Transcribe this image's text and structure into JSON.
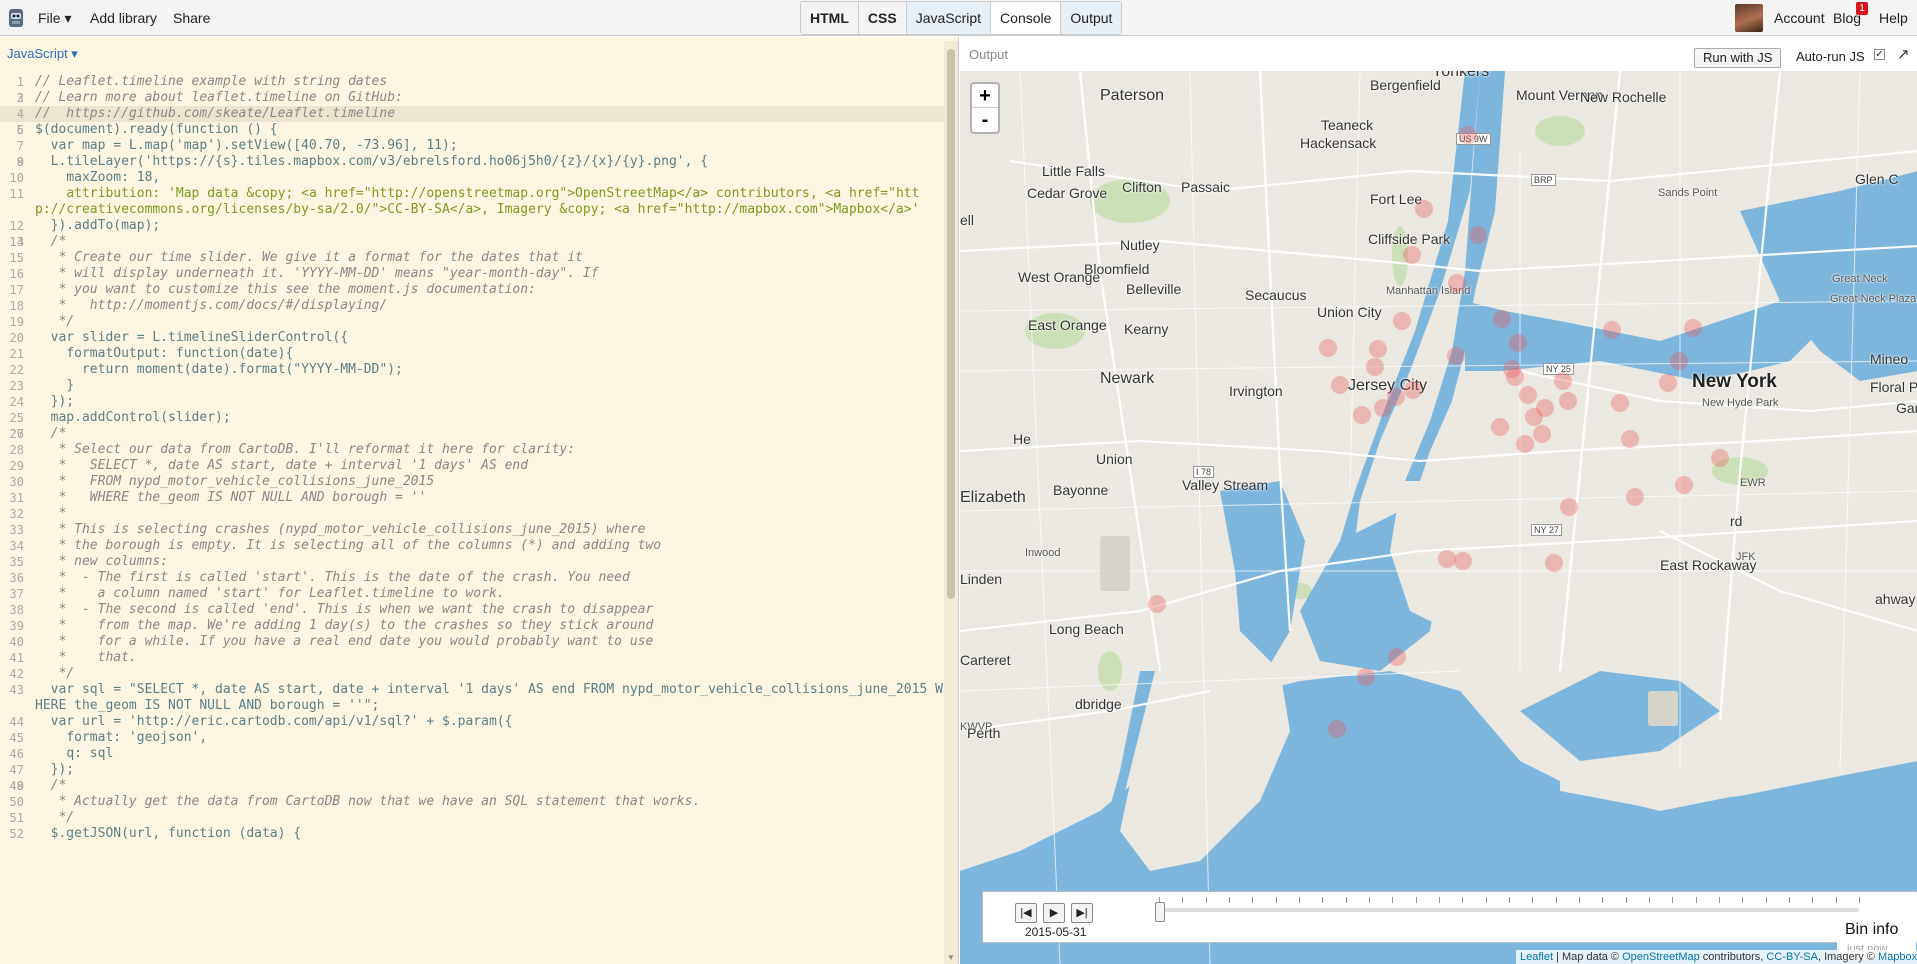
{
  "topbar": {
    "menus": [
      {
        "label": "File ▾"
      },
      {
        "label": "Add library"
      },
      {
        "label": "Share"
      }
    ],
    "panels": [
      {
        "label": "HTML",
        "state": "bold"
      },
      {
        "label": "CSS",
        "state": "bold"
      },
      {
        "label": "JavaScript",
        "state": "on"
      },
      {
        "label": "Console",
        "state": ""
      },
      {
        "label": "Output",
        "state": "on"
      }
    ],
    "account_label": "Account",
    "blog_label": "Blog",
    "blog_badge": "1",
    "help_label": "Help"
  },
  "editor": {
    "language_label": "JavaScript ▾",
    "lines": [
      {
        "n": "1",
        "t": "// Leaflet.timeline example with string dates",
        "k": "com"
      },
      {
        "n": "2",
        "t": "",
        "k": ""
      },
      {
        "n": "3",
        "t": "// Learn more about leaflet.timeline on GitHub:",
        "k": "com"
      },
      {
        "n": "4",
        "t": "//  https://github.com/skeate/Leaflet.timeline",
        "k": "com",
        "hl": true
      },
      {
        "n": "5",
        "t": "",
        "k": ""
      },
      {
        "n": "6",
        "t": "$(document).ready(function () {",
        "k": "code"
      },
      {
        "n": "7",
        "t": "  var map = L.map('map').setView([40.70, -73.96], 11);",
        "k": "code"
      },
      {
        "n": "8",
        "t": "",
        "k": ""
      },
      {
        "n": "9",
        "t": "  L.tileLayer('https://{s}.tiles.mapbox.com/v3/ebrelsford.ho06j5h0/{z}/{x}/{y}.png', {",
        "k": "code"
      },
      {
        "n": "10",
        "t": "    maxZoom: 18,",
        "k": "code"
      },
      {
        "n": "11",
        "t": "    attribution: 'Map data &copy; <a href=\"http://openstreetmap.org\">OpenStreetMap</a> contributors, <a href=\"http://creativecommons.org/licenses/by-sa/2.0/\">CC-BY-SA</a>, Imagery &copy; <a href=\"http://mapbox.com\">Mapbox</a>'",
        "k": "str"
      },
      {
        "n": "12",
        "t": "  }).addTo(map);",
        "k": "code"
      },
      {
        "n": "13",
        "t": "",
        "k": ""
      },
      {
        "n": "14",
        "t": "  /*",
        "k": "com"
      },
      {
        "n": "15",
        "t": "   * Create our time slider. We give it a format for the dates that it",
        "k": "com"
      },
      {
        "n": "16",
        "t": "   * will display underneath it. 'YYYY-MM-DD' means \"year-month-day\". If",
        "k": "com"
      },
      {
        "n": "17",
        "t": "   * you want to customize this see the moment.js documentation:",
        "k": "com"
      },
      {
        "n": "18",
        "t": "   *   http://momentjs.com/docs/#/displaying/",
        "k": "com"
      },
      {
        "n": "19",
        "t": "   */",
        "k": "com"
      },
      {
        "n": "20",
        "t": "  var slider = L.timelineSliderControl({",
        "k": "code"
      },
      {
        "n": "21",
        "t": "    formatOutput: function(date){",
        "k": "code"
      },
      {
        "n": "22",
        "t": "      return moment(date).format(\"YYYY-MM-DD\");",
        "k": "code"
      },
      {
        "n": "23",
        "t": "    }",
        "k": "code"
      },
      {
        "n": "24",
        "t": "  });",
        "k": "code"
      },
      {
        "n": "25",
        "t": "  map.addControl(slider);",
        "k": "code"
      },
      {
        "n": "26",
        "t": "",
        "k": ""
      },
      {
        "n": "27",
        "t": "  /*",
        "k": "com"
      },
      {
        "n": "28",
        "t": "   * Select our data from CartoDB. I'll reformat it here for clarity:",
        "k": "com"
      },
      {
        "n": "29",
        "t": "   *   SELECT *, date AS start, date + interval '1 days' AS end",
        "k": "com"
      },
      {
        "n": "30",
        "t": "   *   FROM nypd_motor_vehicle_collisions_june_2015",
        "k": "com"
      },
      {
        "n": "31",
        "t": "   *   WHERE the_geom IS NOT NULL AND borough = ''",
        "k": "com"
      },
      {
        "n": "32",
        "t": "   *",
        "k": "com"
      },
      {
        "n": "33",
        "t": "   * This is selecting crashes (nypd_motor_vehicle_collisions_june_2015) where",
        "k": "com"
      },
      {
        "n": "34",
        "t": "   * the borough is empty. It is selecting all of the columns (*) and adding two",
        "k": "com"
      },
      {
        "n": "35",
        "t": "   * new columns:",
        "k": "com"
      },
      {
        "n": "36",
        "t": "   *  - The first is called 'start'. This is the date of the crash. You need",
        "k": "com"
      },
      {
        "n": "37",
        "t": "   *    a column named 'start' for Leaflet.timeline to work.",
        "k": "com"
      },
      {
        "n": "38",
        "t": "   *  - The second is called 'end'. This is when we want the crash to disappear",
        "k": "com"
      },
      {
        "n": "39",
        "t": "   *    from the map. We're adding 1 day(s) to the crashes so they stick around",
        "k": "com"
      },
      {
        "n": "40",
        "t": "   *    for a while. If you have a real end date you would probably want to use",
        "k": "com"
      },
      {
        "n": "41",
        "t": "   *    that.",
        "k": "com"
      },
      {
        "n": "42",
        "t": "   */",
        "k": "com"
      },
      {
        "n": "43",
        "t": "  var sql = \"SELECT *, date AS start, date + interval '1 days' AS end FROM nypd_motor_vehicle_collisions_june_2015 WHERE the_geom IS NOT NULL AND borough = ''\";",
        "k": "code"
      },
      {
        "n": "44",
        "t": "  var url = 'http://eric.cartodb.com/api/v1/sql?' + $.param({",
        "k": "code"
      },
      {
        "n": "45",
        "t": "    format: 'geojson',",
        "k": "code"
      },
      {
        "n": "46",
        "t": "    q: sql",
        "k": "code"
      },
      {
        "n": "47",
        "t": "  });",
        "k": "code"
      },
      {
        "n": "48",
        "t": "",
        "k": ""
      },
      {
        "n": "49",
        "t": "  /*",
        "k": "com"
      },
      {
        "n": "50",
        "t": "   * Actually get the data from CartoDB now that we have an SQL statement that works.",
        "k": "com"
      },
      {
        "n": "51",
        "t": "   */",
        "k": "com"
      },
      {
        "n": "52",
        "t": "  $.getJSON(url, function (data) {",
        "k": "code"
      }
    ]
  },
  "output": {
    "title": "Output",
    "run_button": "Run with JS",
    "autorun_label": "Auto-run JS",
    "autorun_checked": "✓",
    "expand_icon": "↗"
  },
  "map": {
    "zoom_in": "+",
    "zoom_out": "-",
    "places": [
      {
        "name": "Bergenfield",
        "cls": ""
      },
      {
        "name": "Yonkers",
        "cls": "mid"
      },
      {
        "name": "Paterson",
        "cls": "mid"
      },
      {
        "name": "Mount Vernon",
        "cls": ""
      },
      {
        "name": "New Rochelle",
        "cls": ""
      },
      {
        "name": "Teaneck",
        "cls": ""
      },
      {
        "name": "Hackensack",
        "cls": ""
      },
      {
        "name": "Little Falls",
        "cls": ""
      },
      {
        "name": "Cedar Grove",
        "cls": ""
      },
      {
        "name": "Clifton",
        "cls": ""
      },
      {
        "name": "Passaic",
        "cls": ""
      },
      {
        "name": "Fort Lee",
        "cls": ""
      },
      {
        "name": "Glen C",
        "cls": ""
      },
      {
        "name": "Sands Point",
        "cls": "small"
      },
      {
        "name": "Cliffside Park",
        "cls": ""
      },
      {
        "name": "Nutley",
        "cls": ""
      },
      {
        "name": "West Orange",
        "cls": ""
      },
      {
        "name": "Bloomfield",
        "cls": ""
      },
      {
        "name": "Belleville",
        "cls": ""
      },
      {
        "name": "Manhattan Island",
        "cls": "small"
      },
      {
        "name": "Great Neck",
        "cls": "small"
      },
      {
        "name": "Great Neck Plaza",
        "cls": "small"
      },
      {
        "name": "Secaucus",
        "cls": ""
      },
      {
        "name": "Union City",
        "cls": ""
      },
      {
        "name": "East Orange",
        "cls": ""
      },
      {
        "name": "Kearny",
        "cls": ""
      },
      {
        "name": "Mineo",
        "cls": ""
      },
      {
        "name": "Newark",
        "cls": "mid"
      },
      {
        "name": "Irvington",
        "cls": ""
      },
      {
        "name": "Jersey City",
        "cls": "mid"
      },
      {
        "name": "New York",
        "cls": "big"
      },
      {
        "name": "New Hyde Park",
        "cls": "small"
      },
      {
        "name": "Floral Park",
        "cls": ""
      },
      {
        "name": "Garo",
        "cls": ""
      },
      {
        "name": "He",
        "cls": ""
      },
      {
        "name": "Union",
        "cls": ""
      },
      {
        "name": "EWR",
        "cls": "small"
      },
      {
        "name": "Valley Stream",
        "cls": ""
      },
      {
        "name": "Bayonne",
        "cls": ""
      },
      {
        "name": "Elizabeth",
        "cls": "mid"
      },
      {
        "name": "rd",
        "cls": ""
      },
      {
        "name": "East Rockaway",
        "cls": ""
      },
      {
        "name": "JFK",
        "cls": "small"
      },
      {
        "name": "Inwood",
        "cls": "small"
      },
      {
        "name": "Linden",
        "cls": ""
      },
      {
        "name": "ahway",
        "cls": ""
      },
      {
        "name": "Long Beach",
        "cls": ""
      },
      {
        "name": "Carteret",
        "cls": ""
      },
      {
        "name": "dbridge",
        "cls": ""
      },
      {
        "name": "KWVP",
        "cls": "small"
      },
      {
        "name": "Perth",
        "cls": ""
      },
      {
        "name": "ell",
        "cls": ""
      }
    ],
    "shields": [
      "US 9W",
      "BRP",
      "I 78",
      "NY 25",
      "NY 27"
    ],
    "timeline": {
      "date": "2015-05-31",
      "btn_start": "|◀",
      "btn_play": "▶",
      "btn_end": "▶|"
    },
    "bin_info": {
      "title": "Bin info",
      "subtitle": "just now"
    },
    "attribution": {
      "leaflet": "Leaflet",
      "sep1": " | Map data © ",
      "osm": "OpenStreetMap",
      "mid": " contributors, ",
      "ccbysa": "CC-BY-SA",
      "imagery": ", Imagery © ",
      "mapbox": "Mapbox"
    }
  }
}
